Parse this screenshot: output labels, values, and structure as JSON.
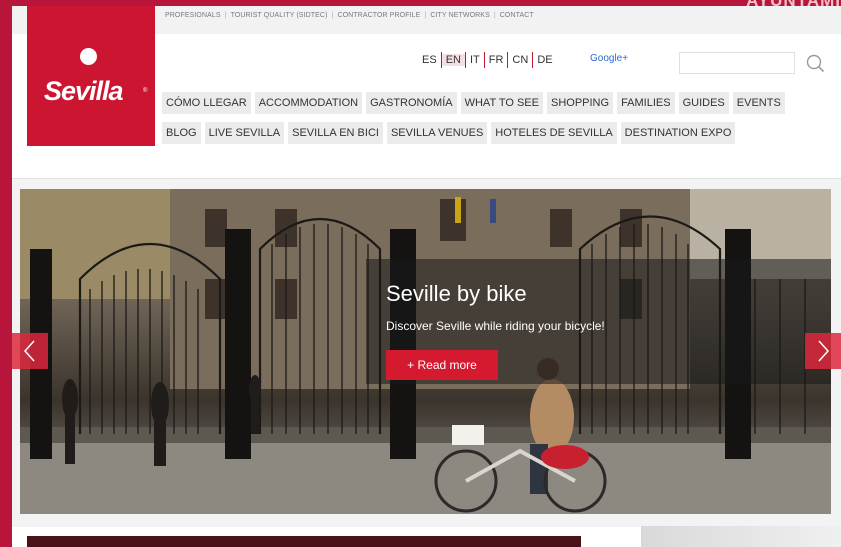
{
  "utility_links": [
    "PROFESIONALS",
    "TOURIST QUALITY (SIDTEC)",
    "CONTRACTOR PROFILE",
    "CITY NETWORKS",
    "CONTACT"
  ],
  "corner_text": "AYUNTAMI",
  "logo": {
    "text": "Sevilla",
    "reg": "®"
  },
  "languages": [
    "ES",
    "EN",
    "IT",
    "FR",
    "CN",
    "DE"
  ],
  "active_language": "EN",
  "google_plus": "Google+",
  "search": {
    "placeholder": ""
  },
  "nav_row1": [
    "CÓMO LLEGAR",
    "ACCOMMODATION",
    "GASTRONOMÍA",
    "WHAT TO SEE",
    "SHOPPING",
    "FAMILIES",
    "GUIDES",
    "EVENTS"
  ],
  "nav_row2": [
    "BLOG",
    "LIVE SEVILLA",
    "SEVILLA EN BICI",
    "SEVILLA VENUES",
    "HOTELES DE SEVILLA",
    "DESTINATION EXPO"
  ],
  "slide": {
    "title": "Seville by bike",
    "subtitle": "Discover Seville while riding your bicycle!",
    "button": "+ Read more"
  },
  "colors": {
    "brand_red": "#cc1530",
    "frame": "#b8153a",
    "button": "#d51a30"
  }
}
